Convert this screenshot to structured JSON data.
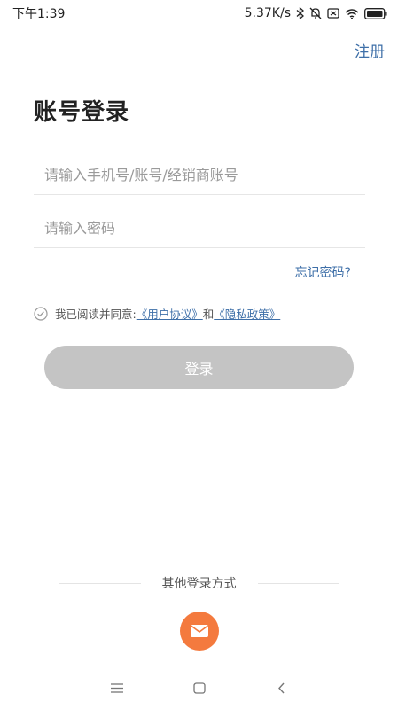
{
  "status_bar": {
    "time": "下午1:39",
    "network_speed": "5.37K/s",
    "icons": [
      "bluetooth-icon",
      "mute-icon",
      "sim-icon",
      "wifi-icon",
      "battery-icon"
    ]
  },
  "header": {
    "register_label": "注册"
  },
  "login_form": {
    "title": "账号登录",
    "account_placeholder": "请输入手机号/账号/经销商账号",
    "account_value": "",
    "password_placeholder": "请输入密码",
    "password_value": "",
    "forgot_password": "忘记密码?",
    "agreement": {
      "prefix": "我已阅读并同意:",
      "user_agreement": "《用户协议》",
      "conjunction": "和",
      "privacy_policy": "《隐私政策》"
    },
    "submit_label": "登录"
  },
  "other_login": {
    "label": "其他登录方式",
    "methods": [
      "mail-icon"
    ]
  },
  "colors": {
    "link": "#3e6fa8",
    "button_disabled": "#c4c4c4",
    "mail_button": "#f47a3e"
  }
}
